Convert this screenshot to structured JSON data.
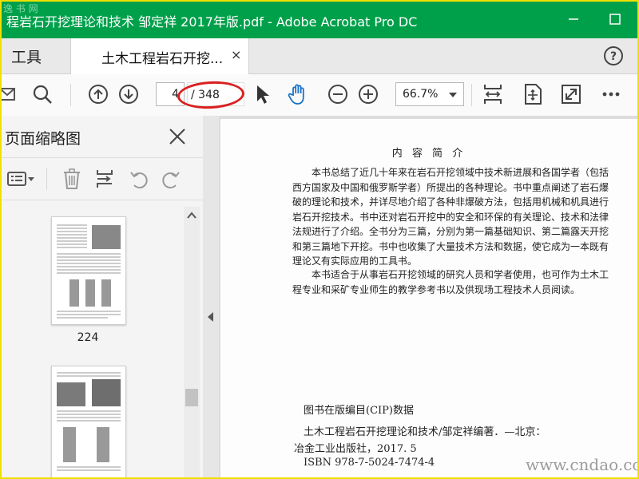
{
  "window": {
    "title": "程岩石开挖理论和技术 邹定祥 2017年版.pdf - Adobe Acrobat Pro DC",
    "watermark_top": "逸 书 网",
    "accent_color": "#00a04b"
  },
  "tabs": {
    "tools_label": "工具",
    "doc_label": "土木工程岩石开挖...",
    "close_symbol": "×"
  },
  "toolbar": {
    "page_current": "4",
    "page_total": "/ 348",
    "zoom": "66.7%",
    "icons": [
      "email-icon",
      "search-icon",
      "page-up-icon",
      "page-down-icon",
      "select-pointer-icon",
      "hand-tool-icon",
      "zoom-out-icon",
      "zoom-in-icon",
      "fit-width-icon",
      "rotate-page-icon",
      "full-screen-icon",
      "more-icon"
    ]
  },
  "panel": {
    "title": "页面缩略图",
    "thumbnails": [
      {
        "label": "224"
      },
      {
        "label": ""
      }
    ]
  },
  "document": {
    "heading": "内 容 简 介",
    "paragraphs": [
      "本书总结了近几十年来在岩石开挖领域中技术新进展和各国学者（包括西方国家及中国和俄罗斯学者）所提出的各种理论。书中重点阐述了岩石爆破的理论和技术，并详尽地介绍了各种非爆破方法，包括用机械和机具进行岩石开挖技术。书中还对岩石开挖中的安全和环保的有关理论、技术和法律法规进行了介绍。全书分为三篇，分别为第一篇基础知识、第二篇露天开挖和第三篇地下开挖。书中也收集了大量技术方法和数据，使它成为一本既有理论又有实际应用的工具书。",
      "本书适合于从事岩石开挖领域的研究人员和学者使用，也可作为土木工程专业和采矿专业师生的教学参考书以及供现场工程技术人员阅读。"
    ],
    "cip_heading": "图书在版编目(CIP)数据",
    "cip_line1": "土木工程岩石开挖理论和技术/邹定祥编著．—北京：",
    "cip_line2": "冶金工业出版社，2017. 5",
    "cip_line3": "ISBN 978-7-5024-7474-4"
  },
  "watermark_site": "www.cndao.com"
}
